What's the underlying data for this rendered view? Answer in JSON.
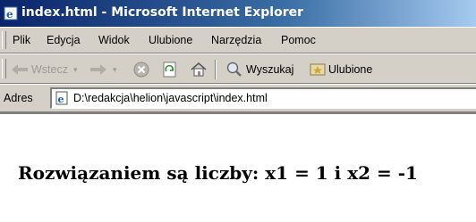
{
  "window": {
    "title": "index.html - Microsoft Internet Explorer",
    "icon": "ie-page-icon"
  },
  "menu": {
    "items": [
      "Plik",
      "Edycja",
      "Widok",
      "Ulubione",
      "Narzędzia",
      "Pomoc"
    ]
  },
  "toolbar": {
    "back_label": "Wstecz",
    "back_icon": "arrow-left-icon",
    "forward_icon": "arrow-right-icon",
    "stop_icon": "stop-icon",
    "refresh_icon": "refresh-icon",
    "home_icon": "home-icon",
    "search_label": "Wyszukaj",
    "search_icon": "search-icon",
    "favorites_label": "Ulubione",
    "favorites_icon": "favorites-icon"
  },
  "address": {
    "label": "Adres",
    "url": "D:\\redakcja\\helion\\javascript\\index.html"
  },
  "content": {
    "text": "Rozwiązaniem są liczby: x1 = 1 i x2 = -1"
  },
  "colors": {
    "titlebar_start": "#0a246a",
    "titlebar_end": "#a6caf0",
    "chrome": "#d4d0c8"
  }
}
